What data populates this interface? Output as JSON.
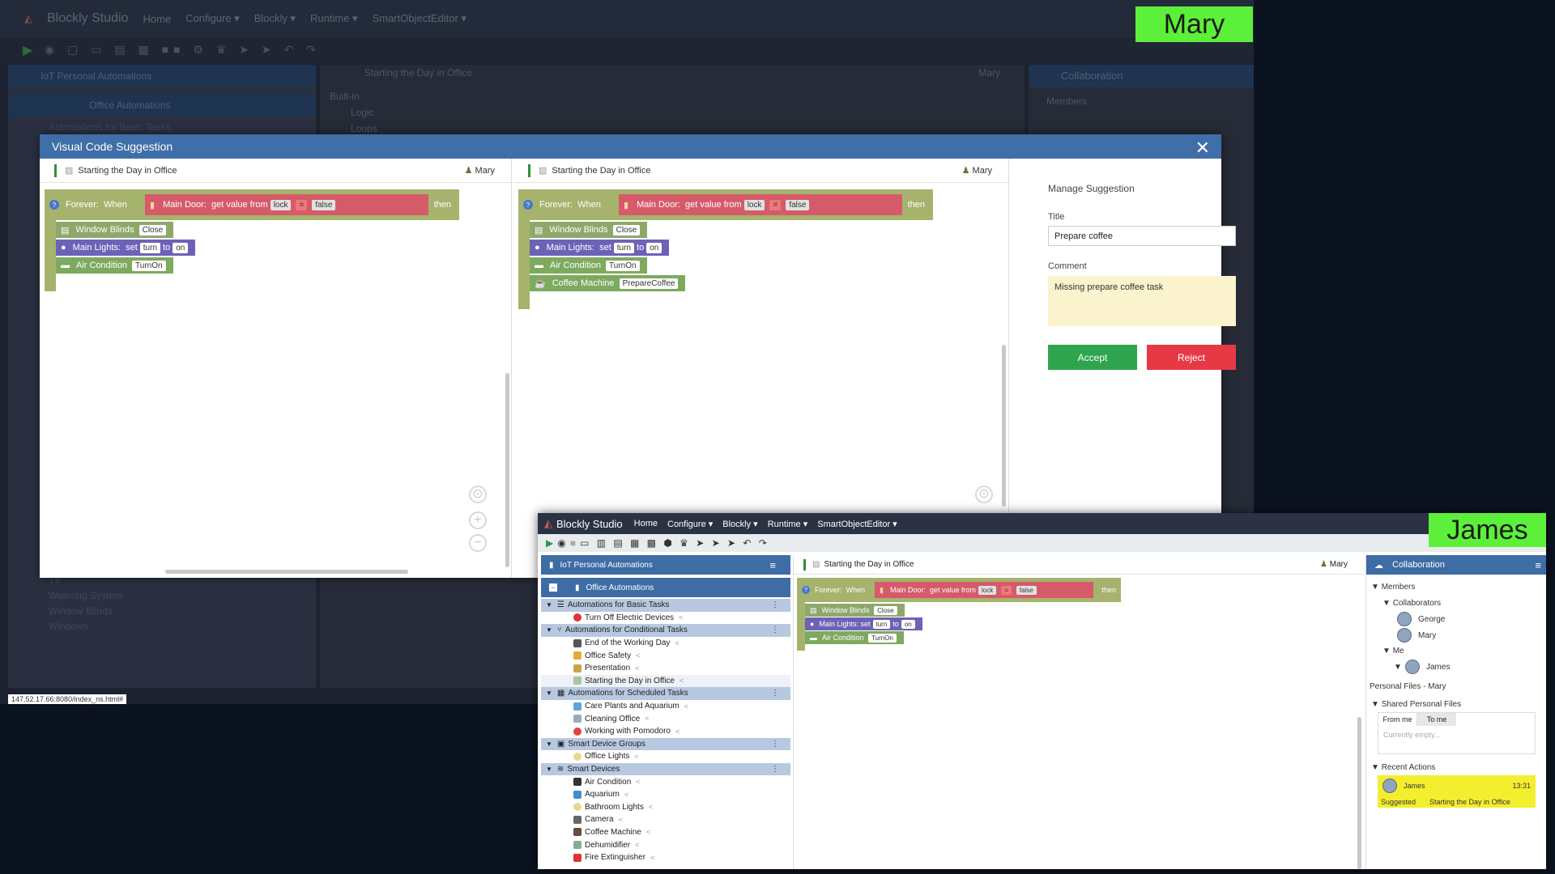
{
  "mary_window": {
    "brand": "Blockly Studio",
    "menu": [
      "Home",
      "Configure ▾",
      "Blockly ▾",
      "Runtime ▾",
      "SmartObjectEditor ▾"
    ],
    "sidebar_header": "IoT Personal Automations",
    "sidebar_sub": "Office Automations",
    "sidebar_group": "Automations for Basic Tasks",
    "sidebar_items": [
      "TV",
      "Watering System",
      "Window Blinds",
      "Windows"
    ],
    "workspace_title": "Starting the Day in Office",
    "workspace_user": "Mary",
    "toolbox": [
      "Built-in",
      "Logic",
      "Loops"
    ],
    "collab_header": "Collaboration",
    "collab_members": "Members",
    "status_url": "147.52.17.66:8080/index_ns.html#"
  },
  "mary_badge": "Mary",
  "modal": {
    "title": "Visual Code Suggestion",
    "left_pane": {
      "header": "Starting the Day in Office",
      "user": "Mary",
      "forever": "Forever:",
      "when": "When",
      "then": "then",
      "door_label": "Main Door:",
      "door_get": "get value from",
      "door_prop": "lock",
      "door_op": "=",
      "door_val": "false",
      "wb_label": "Window Blinds",
      "wb_val": "Close",
      "ml_label": "Main Lights:",
      "ml_set": "set",
      "ml_prop": "turn",
      "ml_to": "to",
      "ml_val": "on",
      "ac_label": "Air Condition",
      "ac_val": "TurnOn"
    },
    "right_pane": {
      "header": "Starting the Day in Office",
      "user": "Mary",
      "forever": "Forever:",
      "when": "When",
      "then": "then",
      "door_label": "Main Door:",
      "door_get": "get value from",
      "door_prop": "lock",
      "door_op": "=",
      "door_val": "false",
      "wb_label": "Window Blinds",
      "wb_val": "Close",
      "ml_label": "Main Lights:",
      "ml_set": "set",
      "ml_prop": "turn",
      "ml_to": "to",
      "ml_val": "on",
      "ac_label": "Air Condition",
      "ac_val": "TurnOn",
      "cm_label": "Coffee Machine",
      "cm_val": "PrepareCoffee"
    },
    "manage": {
      "heading": "Manage Suggestion",
      "title_label": "Title",
      "title_value": "Prepare coffee",
      "comment_label": "Comment",
      "comment_value": "Missing prepare coffee task",
      "accept": "Accept",
      "reject": "Reject"
    }
  },
  "james_window": {
    "brand": "Blockly Studio",
    "menu": [
      "Home",
      "Configure ▾",
      "Blockly ▾",
      "Runtime ▾",
      "SmartObjectEditor ▾"
    ],
    "tree_header": "IoT Personal Automations",
    "tree_sub": "Office Automations",
    "groups": [
      {
        "label": "Automations for Basic Tasks",
        "items": [
          "Turn Off Electric Devices"
        ]
      },
      {
        "label": "Automations for Conditional Tasks",
        "items": [
          "End of the Working Day",
          "Office Safety",
          "Presentation",
          "Starting the Day in Office"
        ]
      },
      {
        "label": "Automations for Scheduled Tasks",
        "items": [
          "Care Plants and Aquarium",
          "Cleaning Office",
          "Working with Pomodoro"
        ]
      },
      {
        "label": "Smart Device Groups",
        "items": [
          "Office Lights"
        ]
      },
      {
        "label": "Smart Devices",
        "items": [
          "Air Condition",
          "Aquarium",
          "Bathroom Lights",
          "Camera",
          "Coffee Machine",
          "Dehumidifier",
          "Fire Extinguisher"
        ]
      }
    ],
    "workspace": {
      "title": "Starting the Day in Office",
      "user": "Mary",
      "forever": "Forever:",
      "when": "When",
      "then": "then",
      "door_label": "Main Door:",
      "door_get": "get value from",
      "door_prop": "lock",
      "door_op": "=",
      "door_val": "false",
      "wb_label": "Window Blinds",
      "wb_val": "Close",
      "ml_label": "Main Lights:",
      "ml_set": "set",
      "ml_prop": "turn",
      "ml_to": "to",
      "ml_val": "on",
      "ac_label": "Air Condition",
      "ac_val": "TurnOn"
    },
    "collab": {
      "header": "Collaboration",
      "members": "Members",
      "collaborators": "Collaborators",
      "c1": "George",
      "c2": "Mary",
      "me": "Me",
      "me_name": "James",
      "personal_files": "Personal Files - Mary",
      "shared": "Shared Personal Files",
      "tab_from": "From me",
      "tab_to": "To me",
      "empty": "Currently empty...",
      "recent": "Recent Actions",
      "action_user": "James",
      "action_time": "13:31",
      "action_text": "Suggested",
      "action_target": "Starting the Day in Office"
    }
  },
  "james_badge": "James",
  "colors": {
    "badge": "#5cf03a",
    "header_blue": "#3e6ca5",
    "accept": "#2fa44f",
    "reject": "#e63946",
    "comment_bg": "#fbf3cd"
  }
}
